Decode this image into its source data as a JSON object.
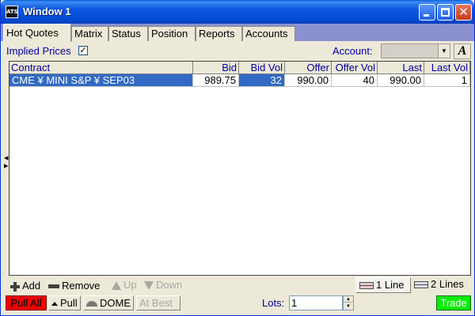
{
  "window": {
    "title": "Window 1",
    "icon_text": "ATS"
  },
  "tabs": [
    {
      "label": "Hot Quotes",
      "active": true
    },
    {
      "label": "Matrix"
    },
    {
      "label": "Status"
    },
    {
      "label": "Position"
    },
    {
      "label": "Reports"
    },
    {
      "label": "Accounts"
    }
  ],
  "options": {
    "implied_prices_label": "Implied Prices",
    "implied_prices_checked": true,
    "account_label": "Account:",
    "account_value": "",
    "font_button_label": "A"
  },
  "grid": {
    "columns": [
      "Contract",
      "Bid",
      "Bid Vol",
      "Offer",
      "Offer Vol",
      "Last",
      "Last Vol"
    ],
    "rows": [
      {
        "contract": "CME ¥ MINI S&P ¥ SEP03",
        "bid": "989.75",
        "bid_vol": "32",
        "offer": "990.00",
        "offer_vol": "40",
        "last": "990.00",
        "last_vol": "1"
      }
    ]
  },
  "toolbar": {
    "add_label": "Add",
    "remove_label": "Remove",
    "up_label": "Up",
    "down_label": "Down",
    "one_line_label": "1 Line",
    "two_lines_label": "2 Lines",
    "pull_all_label": "Pull All",
    "pull_label": "Pull",
    "dome_label": "DOME",
    "at_best_label": "At Best",
    "lots_label": "Lots:",
    "lots_value": "1",
    "trade_label": "Trade"
  },
  "colors": {
    "selection": "#316ac5",
    "pull_all": "#ee0000",
    "trade": "#00ee00",
    "header_text": "#00009c"
  }
}
